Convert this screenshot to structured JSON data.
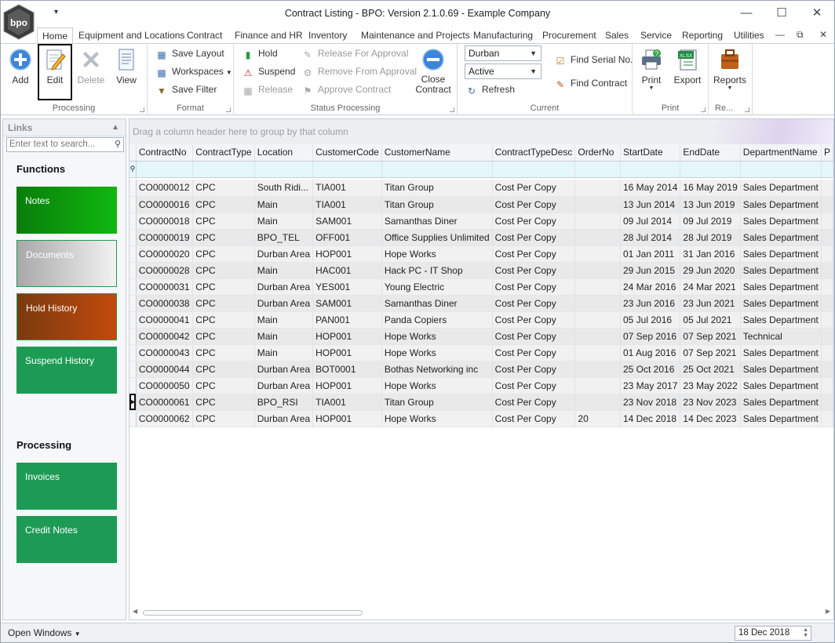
{
  "window": {
    "title": "Contract Listing - BPO: Version 2.1.0.69 - Example Company",
    "logo_text": "bpo",
    "minimize": "—",
    "maximize": "☐",
    "close": "✕",
    "qat": "▾"
  },
  "tabs": [
    {
      "label": "Home",
      "active": true
    },
    {
      "label": "Equipment and Locations"
    },
    {
      "label": "Contract"
    },
    {
      "label": "Finance and HR"
    },
    {
      "label": "Inventory"
    },
    {
      "label": "Maintenance and Projects"
    },
    {
      "label": "Manufacturing"
    },
    {
      "label": "Procurement"
    },
    {
      "label": "Sales"
    },
    {
      "label": "Service"
    },
    {
      "label": "Reporting"
    },
    {
      "label": "Utilities"
    }
  ],
  "mdi": {
    "minimize": "—",
    "restore": "⧉",
    "close": "✕"
  },
  "ribbon": {
    "processing": {
      "label": "Processing",
      "add": "Add",
      "edit": "Edit",
      "delete": "Delete",
      "view": "View"
    },
    "format": {
      "label": "Format",
      "save_layout": "Save Layout",
      "workspaces": "Workspaces",
      "save_filter": "Save Filter"
    },
    "status": {
      "label": "Status Processing",
      "hold": "Hold",
      "suspend": "Suspend",
      "release": "Release",
      "release_for_approval": "Release For Approval",
      "remove_from_approval": "Remove From Approval",
      "approve_contract": "Approve Contract",
      "close_contract_1": "Close",
      "close_contract_2": "Contract"
    },
    "current": {
      "label": "Current",
      "location": "Durban",
      "status": "Active",
      "refresh": "Refresh",
      "find_serial": "Find Serial No.",
      "find_contract": "Find Contract"
    },
    "print": {
      "label": "Print",
      "print": "Print",
      "export": "Export",
      "xlsx": "XLSX"
    },
    "reports": {
      "label": "Re...",
      "reports": "Reports"
    }
  },
  "links": {
    "header": "Links",
    "search_placeholder": "Enter text to search...",
    "functions_title": "Functions",
    "functions": [
      {
        "label": "Notes",
        "color": "#0ca40c"
      },
      {
        "label": "Documents",
        "color": "#c8c8c8"
      },
      {
        "label": "Hold History",
        "color": "#a64010"
      },
      {
        "label": "Suspend History",
        "color": "#1d9b55"
      }
    ],
    "processing_title": "Processing",
    "processing": [
      {
        "label": "Invoices",
        "color": "#1d9b55"
      },
      {
        "label": "Credit Notes",
        "color": "#1d9b55"
      }
    ]
  },
  "grid": {
    "group_hint": "Drag a column header here to group by that column",
    "columns": [
      "ContractNo",
      "ContractType",
      "Location",
      "CustomerCode",
      "CustomerName",
      "ContractTypeDesc",
      "OrderNo",
      "StartDate",
      "EndDate",
      "DepartmentName",
      "P"
    ],
    "rows": [
      [
        "CO0000012",
        "CPC",
        "South Ridi...",
        "TIA001",
        "Titan Group",
        "Cost Per Copy",
        "",
        "16 May 2014",
        "16 May 2019",
        "Sales Department"
      ],
      [
        "CO0000016",
        "CPC",
        "Main",
        "TIA001",
        "Titan Group",
        "Cost Per Copy",
        "",
        "13 Jun 2014",
        "13 Jun 2019",
        "Sales Department"
      ],
      [
        "CO0000018",
        "CPC",
        "Main",
        "SAM001",
        "Samanthas Diner",
        "Cost Per Copy",
        "",
        "09 Jul 2014",
        "09 Jul 2019",
        "Sales Department"
      ],
      [
        "CO0000019",
        "CPC",
        "BPO_TEL",
        "OFF001",
        "Office Supplies Unlimited",
        "Cost Per Copy",
        "",
        "28 Jul 2014",
        "28 Jul 2019",
        "Sales Department"
      ],
      [
        "CO0000020",
        "CPC",
        "Durban Area",
        "HOP001",
        "Hope Works",
        "Cost Per Copy",
        "",
        "01 Jan 2011",
        "31 Jan 2016",
        "Sales Department"
      ],
      [
        "CO0000028",
        "CPC",
        "Main",
        "HAC001",
        "Hack PC - IT Shop",
        "Cost Per Copy",
        "",
        "29 Jun 2015",
        "29 Jun 2020",
        "Sales Department"
      ],
      [
        "CO0000031",
        "CPC",
        "Durban Area",
        "YES001",
        "Young Electric",
        "Cost Per Copy",
        "",
        "24 Mar 2016",
        "24 Mar 2021",
        "Sales Department"
      ],
      [
        "CO0000038",
        "CPC",
        "Durban Area",
        "SAM001",
        "Samanthas Diner",
        "Cost Per Copy",
        "",
        "23 Jun 2016",
        "23 Jun 2021",
        "Sales Department"
      ],
      [
        "CO0000041",
        "CPC",
        "Main",
        "PAN001",
        "Panda Copiers",
        "Cost Per Copy",
        "",
        "05 Jul 2016",
        "05 Jul 2021",
        "Sales Department"
      ],
      [
        "CO0000042",
        "CPC",
        "Main",
        "HOP001",
        "Hope Works",
        "Cost Per Copy",
        "",
        "07 Sep 2016",
        "07 Sep 2021",
        "Technical"
      ],
      [
        "CO0000043",
        "CPC",
        "Main",
        "HOP001",
        "Hope Works",
        "Cost Per Copy",
        "",
        "01 Aug 2016",
        "07 Sep 2021",
        "Sales Department"
      ],
      [
        "CO0000044",
        "CPC",
        "Durban Area",
        "BOT0001",
        "Bothas Networking inc",
        "Cost Per Copy",
        "",
        "25 Oct 2016",
        "25 Oct 2021",
        "Sales Department"
      ],
      [
        "CO0000050",
        "CPC",
        "Durban Area",
        "HOP001",
        "Hope Works",
        "Cost Per Copy",
        "",
        "23 May 2017",
        "23 May 2022",
        "Sales Department"
      ],
      [
        "CO0000061",
        "CPC",
        "BPO_RSI",
        "TIA001",
        "Titan Group",
        "Cost Per Copy",
        "",
        "23 Nov 2018",
        "23 Nov 2023",
        "Sales Department"
      ],
      [
        "CO0000062",
        "CPC",
        "Durban Area",
        "HOP001",
        "Hope Works",
        "Cost Per Copy",
        "20",
        "14 Dec 2018",
        "14 Dec 2023",
        "Sales Department"
      ]
    ],
    "focused_row": 13
  },
  "statusbar": {
    "open_windows": "Open Windows",
    "date": "18 Dec 2018"
  }
}
